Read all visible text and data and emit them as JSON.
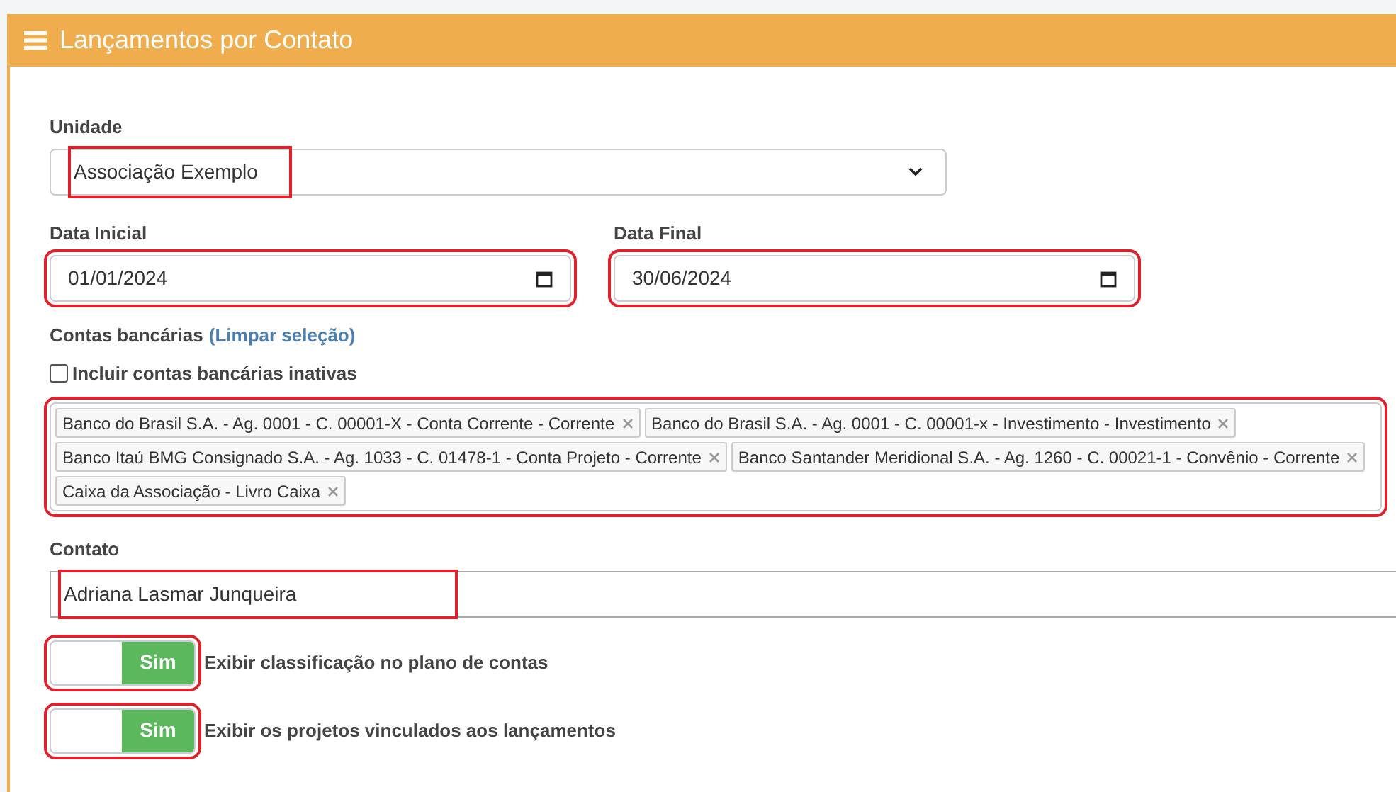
{
  "header": {
    "title": "Lançamentos por Contato"
  },
  "unidade": {
    "label": "Unidade",
    "value": "Associação Exemplo",
    "highlighted": true
  },
  "dates": [
    {
      "label": "Data Inicial",
      "value": "01/01/2024",
      "highlighted": true
    },
    {
      "label": "Data Final",
      "value": "30/06/2024",
      "highlighted": true
    }
  ],
  "contas": {
    "label": "Contas bancárias",
    "clear_link": "(Limpar seleção)",
    "include_inactive": {
      "label": "Incluir contas bancárias inativas",
      "checked": false
    },
    "highlighted": true,
    "tags": [
      "Banco do Brasil S.A. - Ag. 0001 - C. 00001-X - Conta Corrente - Corrente",
      "Banco do Brasil S.A. - Ag. 0001 - C. 00001-x - Investimento - Investimento",
      "Banco Itaú BMG Consignado S.A. - Ag. 1033 - C. 01478-1 - Conta Projeto - Corrente",
      "Banco Santander Meridional S.A. - Ag. 1260 - C. 00021-1 - Convênio - Corrente",
      "Caixa da Associação - Livro Caixa"
    ]
  },
  "contato": {
    "label": "Contato",
    "value": "Adriana Lasmar Junqueira",
    "highlighted": true
  },
  "toggles": [
    {
      "label": "Exibir classificação no plano de contas",
      "state_text": "Sim",
      "on": true,
      "highlighted": true
    },
    {
      "label": "Exibir os projetos vinculados aos lançamentos",
      "state_text": "Sim",
      "on": true,
      "highlighted": true
    }
  ]
}
